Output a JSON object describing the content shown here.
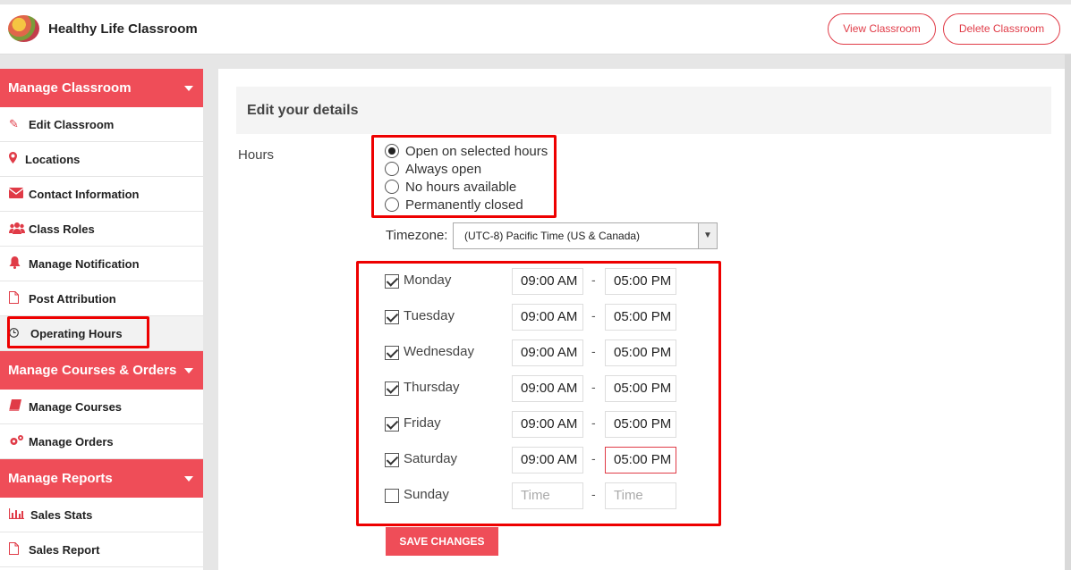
{
  "header": {
    "title": "Healthy Life Classroom",
    "view_button": "View Classroom",
    "delete_button": "Delete Classroom"
  },
  "sidebar": {
    "sections": [
      {
        "title": "Manage Classroom",
        "items": [
          {
            "label": "Edit Classroom",
            "icon": "edit-icon"
          },
          {
            "label": "Locations",
            "icon": "map-pin-icon"
          },
          {
            "label": "Contact Information",
            "icon": "envelope-icon"
          },
          {
            "label": "Class Roles",
            "icon": "users-icon"
          },
          {
            "label": "Manage Notification",
            "icon": "bell-icon"
          },
          {
            "label": "Post Attribution",
            "icon": "file-icon"
          },
          {
            "label": "Operating Hours",
            "icon": "clock-icon",
            "active": true
          }
        ]
      },
      {
        "title": "Manage Courses & Orders",
        "items": [
          {
            "label": "Manage Courses",
            "icon": "book-icon"
          },
          {
            "label": "Manage Orders",
            "icon": "gears-icon"
          }
        ]
      },
      {
        "title": "Manage Reports",
        "items": [
          {
            "label": "Sales Stats",
            "icon": "bar-chart-icon"
          },
          {
            "label": "Sales Report",
            "icon": "file-icon"
          }
        ]
      }
    ]
  },
  "main": {
    "heading": "Edit your details",
    "hours_label": "Hours",
    "hours_options": [
      {
        "label": "Open on selected hours",
        "selected": true
      },
      {
        "label": "Always open",
        "selected": false
      },
      {
        "label": "No hours available",
        "selected": false
      },
      {
        "label": "Permanently closed",
        "selected": false
      }
    ],
    "timezone_label": "Timezone:",
    "timezone_value": "(UTC-8) Pacific Time (US & Canada)",
    "days": [
      {
        "name": "Monday",
        "checked": true,
        "open": "09:00 AM",
        "close": "05:00 PM"
      },
      {
        "name": "Tuesday",
        "checked": true,
        "open": "09:00 AM",
        "close": "05:00 PM"
      },
      {
        "name": "Wednesday",
        "checked": true,
        "open": "09:00 AM",
        "close": "05:00 PM"
      },
      {
        "name": "Thursday",
        "checked": true,
        "open": "09:00 AM",
        "close": "05:00 PM"
      },
      {
        "name": "Friday",
        "checked": true,
        "open": "09:00 AM",
        "close": "05:00 PM"
      },
      {
        "name": "Saturday",
        "checked": true,
        "open": "09:00 AM",
        "close": "05:00 PM"
      },
      {
        "name": "Sunday",
        "checked": false,
        "open": "",
        "close": ""
      }
    ],
    "time_placeholder": "Time",
    "dash": "-",
    "save_button": "SAVE CHANGES"
  },
  "colors": {
    "accent": "#ef4d58",
    "highlight_box": "#ee0000"
  }
}
